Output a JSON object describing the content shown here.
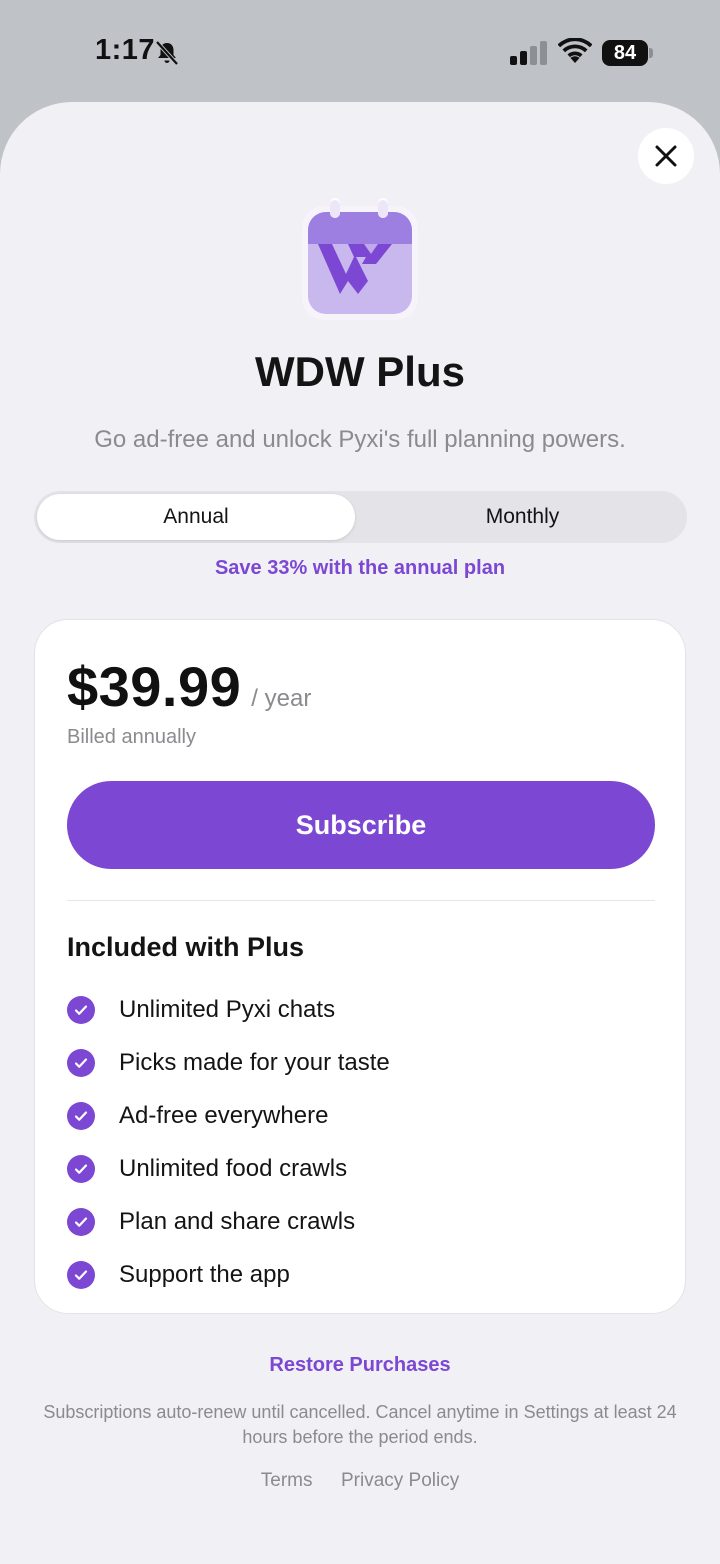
{
  "status_bar": {
    "time": "1:17",
    "battery_level": "84"
  },
  "paywall": {
    "title": "WDW Plus",
    "subtitle": "Go ad-free and unlock Pyxi's full planning powers.",
    "plan_toggle": {
      "options": [
        "Annual",
        "Monthly"
      ],
      "selected": "Annual"
    },
    "save_note": "Save 33% with the annual plan",
    "card": {
      "price": "$39.99",
      "period": "/ year",
      "billing_note": "Billed annually",
      "subscribe_label": "Subscribe",
      "included_title": "Included with Plus",
      "features": [
        "Unlimited Pyxi chats",
        "Picks made for your taste",
        "Ad-free everywhere",
        "Unlimited food crawls",
        "Plan and share crawls",
        "Support the app"
      ]
    },
    "restore_label": "Restore Purchases",
    "legal_text": "Subscriptions auto-renew until cancelled. Cancel anytime in Settings at least 24 hours before the period ends.",
    "links": [
      "Terms",
      "Privacy Policy"
    ]
  },
  "colors": {
    "accent": "#7b47d3",
    "sheet_background": "#f1f1f5",
    "backdrop": "#bfc2c6"
  }
}
